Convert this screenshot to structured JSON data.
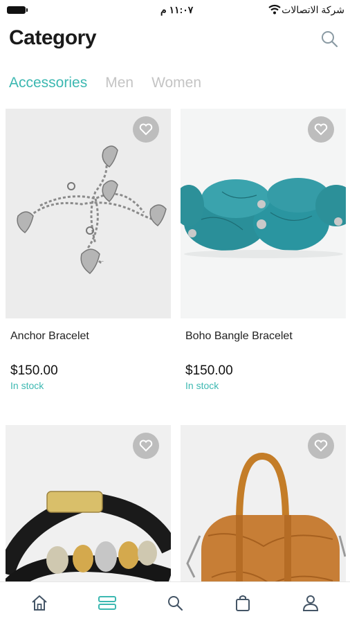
{
  "status_bar": {
    "time": "١١:٠٧ م",
    "carrier": "شركة الاتصالات"
  },
  "header": {
    "title": "Category",
    "search_icon": "search-icon"
  },
  "tabs": [
    {
      "label": "Accessories",
      "active": true
    },
    {
      "label": "Men",
      "active": false
    },
    {
      "label": "Women",
      "active": false
    }
  ],
  "products": [
    {
      "name": "Anchor Bracelet",
      "price": "$150.00",
      "stock": "In stock",
      "image": "heart-charm-bracelet"
    },
    {
      "name": "Boho Bangle Bracelet",
      "price": "$150.00",
      "stock": "In stock",
      "image": "turquoise-bead-bracelet"
    },
    {
      "name": "",
      "price": "",
      "stock": "",
      "image": "leather-bead-bracelet"
    },
    {
      "name": "",
      "price": "",
      "stock": "",
      "image": "brown-leather-handbag"
    }
  ],
  "bottom_nav": [
    {
      "name": "home-icon",
      "active": false
    },
    {
      "name": "list-icon",
      "active": true
    },
    {
      "name": "search-icon",
      "active": false
    },
    {
      "name": "bag-icon",
      "active": false
    },
    {
      "name": "user-icon",
      "active": false
    }
  ],
  "colors": {
    "accent": "#3cb8b1",
    "inactive_tab": "#c4c4c4",
    "nav_icon": "#445566"
  }
}
